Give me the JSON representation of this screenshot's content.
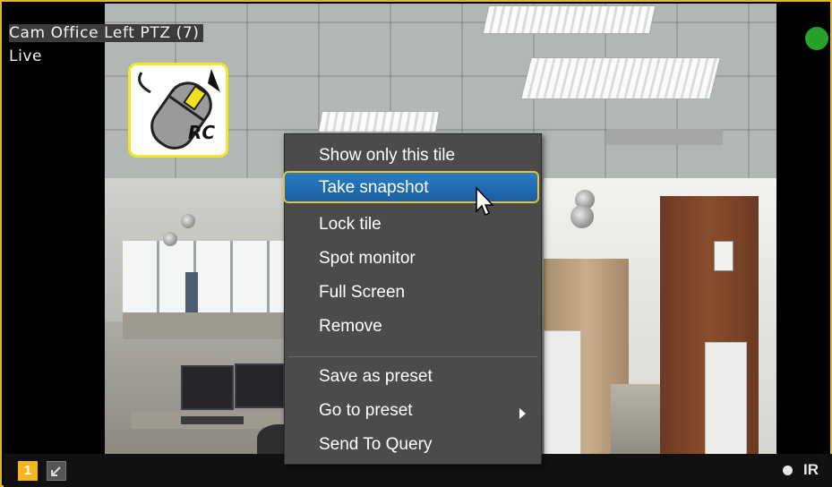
{
  "camera": {
    "title": "Cam Office Left PTZ (7)",
    "mode": "Live",
    "status_color": "#28a12b",
    "badge_icon": "rc-mouse-icon",
    "badge_text": "RC"
  },
  "context_menu": {
    "items": [
      {
        "label": "Show only this tile"
      },
      {
        "label": "Take snapshot",
        "selected": true
      },
      {
        "label": "Lock tile"
      },
      {
        "label": "Spot monitor"
      },
      {
        "label": "Full Screen"
      },
      {
        "label": "Remove"
      },
      {
        "label": "Save as preset"
      },
      {
        "label": "Go to preset",
        "has_submenu": true
      },
      {
        "label": "Send To Query"
      }
    ]
  },
  "bottom_bar": {
    "tile_number": "1",
    "ir_label": "IR",
    "accent_color": "#f5b51f"
  }
}
